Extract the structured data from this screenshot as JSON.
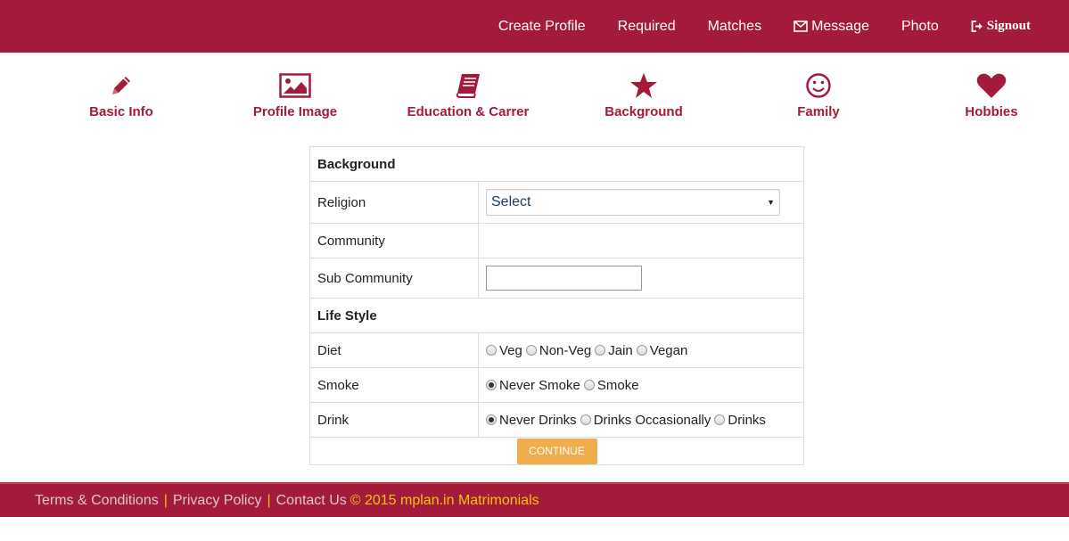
{
  "nav": {
    "create_profile": "Create Profile",
    "required": "Required",
    "matches": "Matches",
    "message": "Message",
    "photo": "Photo",
    "signout": "Signout"
  },
  "steps": [
    {
      "label": "Basic Info",
      "icon": "pencil-icon"
    },
    {
      "label": "Profile Image",
      "icon": "image-icon"
    },
    {
      "label": "Education & Carrer",
      "icon": "book-icon"
    },
    {
      "label": "Background",
      "icon": "star-icon"
    },
    {
      "label": "Family",
      "icon": "smile-icon"
    },
    {
      "label": "Hobbies",
      "icon": "heart-icon"
    }
  ],
  "form": {
    "background_heading": "Background",
    "religion_label": "Religion",
    "religion_value": "Select",
    "community_label": "Community",
    "sub_community_label": "Sub Community",
    "sub_community_value": "",
    "lifestyle_heading": "Life Style",
    "diet_label": "Diet",
    "diet_options": [
      "Veg",
      "Non-Veg",
      "Jain",
      "Vegan"
    ],
    "smoke_label": "Smoke",
    "smoke_options": [
      "Never Smoke",
      "Smoke"
    ],
    "smoke_selected": "Never Smoke",
    "drink_label": "Drink",
    "drink_options": [
      "Never Drinks",
      "Drinks Occasionally",
      "Drinks"
    ],
    "drink_selected": "Never Drinks",
    "continue": "CONTINUE"
  },
  "footer": {
    "terms": "Terms & Conditions",
    "privacy": "Privacy Policy",
    "contact": "Contact Us",
    "separator": "|",
    "copyright": "© 2015 mplan.in Matrimonials"
  },
  "colors": {
    "brand": "#a31a3a",
    "button": "#f0ad4e",
    "footer_accent": "#f1c40f"
  }
}
